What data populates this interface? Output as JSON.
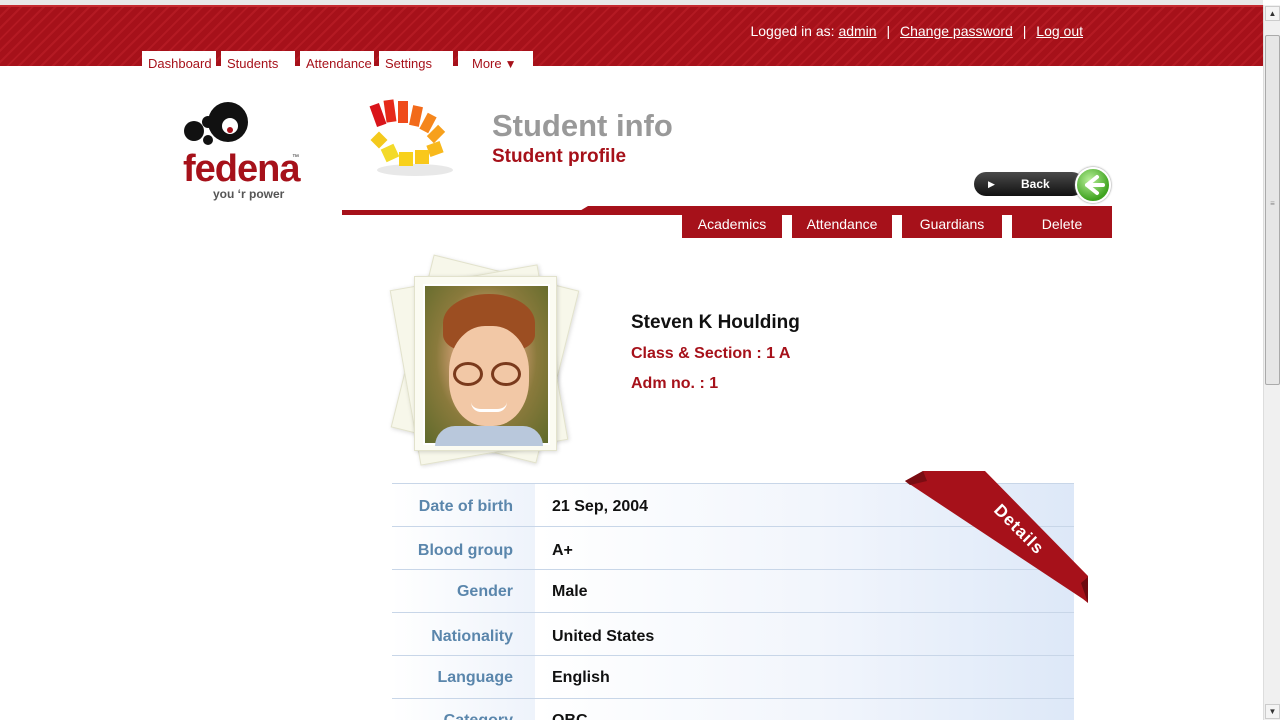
{
  "account": {
    "logged_in_prefix": "Logged in as:",
    "username": "admin",
    "change_password": "Change password",
    "log_out": "Log out",
    "separator": "|"
  },
  "nav": {
    "tabs": [
      {
        "label": "Dashboard"
      },
      {
        "label": "Students"
      },
      {
        "label": "Attendance"
      },
      {
        "label": "Settings"
      },
      {
        "label": "More"
      }
    ]
  },
  "logo": {
    "word": "fedena",
    "tagline": "you ‘r power",
    "tm": "™"
  },
  "header": {
    "title": "Student info",
    "subtitle": "Student profile",
    "back_label": "Back"
  },
  "subtabs": [
    {
      "label": "Academics"
    },
    {
      "label": "Attendance"
    },
    {
      "label": "Guardians"
    },
    {
      "label": "Delete"
    }
  ],
  "student": {
    "name": "Steven K Houlding",
    "class_section": "Class & Section : 1 A",
    "adm_no": "Adm no. : 1"
  },
  "details": {
    "ribbon": "Details",
    "rows": [
      {
        "label": "Date of birth",
        "value": "21 Sep, 2004"
      },
      {
        "label": "Blood group",
        "value": "A+"
      },
      {
        "label": "Gender",
        "value": "Male"
      },
      {
        "label": "Nationality",
        "value": "United States"
      },
      {
        "label": "Language",
        "value": "English"
      },
      {
        "label": "Category",
        "value": "OBC"
      }
    ]
  },
  "colors": {
    "brand_red": "#a6111a",
    "label_blue": "#5a86ac"
  }
}
